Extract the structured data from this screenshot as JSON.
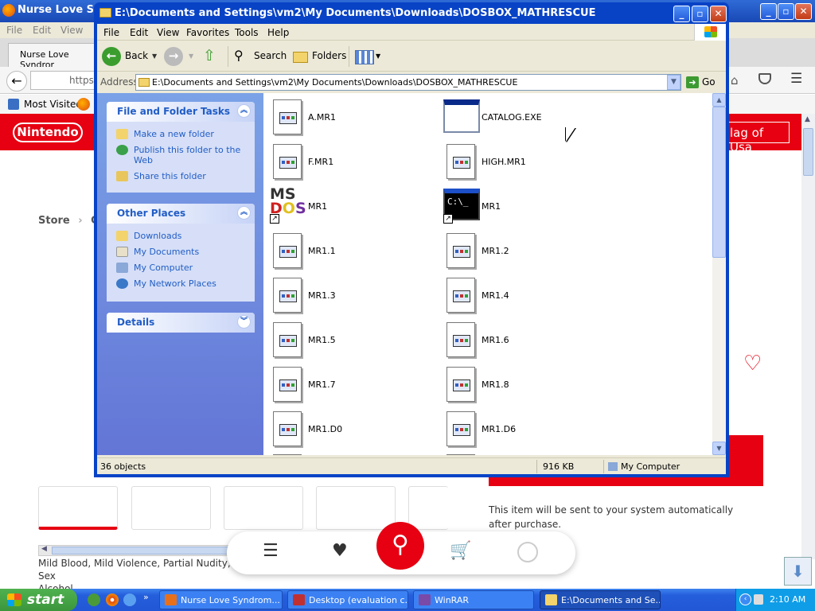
{
  "firefox": {
    "title": "Nurse Love Synd",
    "menu": [
      "File",
      "Edit",
      "View"
    ],
    "tab_label": "Nurse Love Syndror",
    "url_prefix": "https:",
    "bookmark_label": "Most Visited",
    "brand": "Nintendo",
    "search_partial": "lag of Usa",
    "breadcrumb_store": "Store",
    "breadcrumb_next": "Ga",
    "delivery_note": "This item will be sent to your system automatically after purchase.",
    "rating_text": "Mild Blood, Mild Violence, Partial Nudity, Sex",
    "rating_text2": "Alcohol"
  },
  "explorer": {
    "title": "E:\\Documents and Settings\\vm2\\My Documents\\Downloads\\DOSBOX_MATHRESCUE",
    "menu": [
      "File",
      "Edit",
      "View",
      "Favorites",
      "Tools",
      "Help"
    ],
    "toolbar": {
      "back": "Back",
      "search": "Search",
      "folders": "Folders"
    },
    "address_label": "Address",
    "address_value": "E:\\Documents and Settings\\vm2\\My Documents\\Downloads\\DOSBOX_MATHRESCUE",
    "go_label": "Go",
    "tasks_panel": {
      "title": "File and Folder Tasks",
      "items": [
        "Make a new folder",
        "Publish this folder to the Web",
        "Share this folder"
      ]
    },
    "places_panel": {
      "title": "Other Places",
      "items": [
        "Downloads",
        "My Documents",
        "My Computer",
        "My Network Places"
      ]
    },
    "details_panel": {
      "title": "Details"
    },
    "files": [
      {
        "name": "A.MR1",
        "icon": "mr1-file-icon"
      },
      {
        "name": "CATALOG.EXE",
        "icon": "exe-window-icon"
      },
      {
        "name": "F.MR1",
        "icon": "mr1-file-icon"
      },
      {
        "name": "HIGH.MR1",
        "icon": "mr1-file-icon"
      },
      {
        "name": "MR1",
        "icon": "msdos-shortcut-icon"
      },
      {
        "name": "MR1",
        "icon": "cmd-shortcut-icon"
      },
      {
        "name": "MR1.1",
        "icon": "mr1-file-icon"
      },
      {
        "name": "MR1.2",
        "icon": "mr1-file-icon"
      },
      {
        "name": "MR1.3",
        "icon": "mr1-file-icon"
      },
      {
        "name": "MR1.4",
        "icon": "mr1-file-icon"
      },
      {
        "name": "MR1.5",
        "icon": "mr1-file-icon"
      },
      {
        "name": "MR1.6",
        "icon": "mr1-file-icon"
      },
      {
        "name": "MR1.7",
        "icon": "mr1-file-icon"
      },
      {
        "name": "MR1.8",
        "icon": "mr1-file-icon"
      },
      {
        "name": "MR1.D0",
        "icon": "mr1-file-icon"
      },
      {
        "name": "MR1.D6",
        "icon": "mr1-file-icon"
      }
    ],
    "status": {
      "count": "36 objects",
      "size": "916 KB",
      "zone": "My Computer"
    }
  },
  "taskbar": {
    "start": "start",
    "tasks": [
      {
        "label": "Nurse Love Syndrom...",
        "active": false
      },
      {
        "label": "Desktop (evaluation c...",
        "active": false
      },
      {
        "label": "WinRAR",
        "active": false
      },
      {
        "label": "E:\\Documents and Se...",
        "active": true
      }
    ],
    "time": "2:10 AM"
  }
}
